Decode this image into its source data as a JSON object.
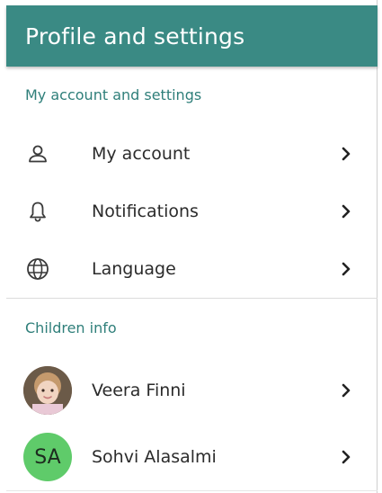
{
  "header": {
    "title": "Profile and settings"
  },
  "sections": {
    "account": {
      "title": "My account and settings",
      "items": [
        {
          "label": "My account",
          "icon": "user-icon"
        },
        {
          "label": "Notifications",
          "icon": "bell-icon"
        },
        {
          "label": "Language",
          "icon": "globe-icon"
        }
      ]
    },
    "children": {
      "title": "Children info",
      "items": [
        {
          "label": "Veera Finni",
          "avatar": "photo"
        },
        {
          "label": "Sohvi Alasalmi",
          "avatar": "initials",
          "initials": "SA"
        }
      ]
    }
  },
  "colors": {
    "header_bg": "#3a8a84",
    "section_title": "#2f7f7a",
    "avatar_green": "#5fcb6a"
  }
}
